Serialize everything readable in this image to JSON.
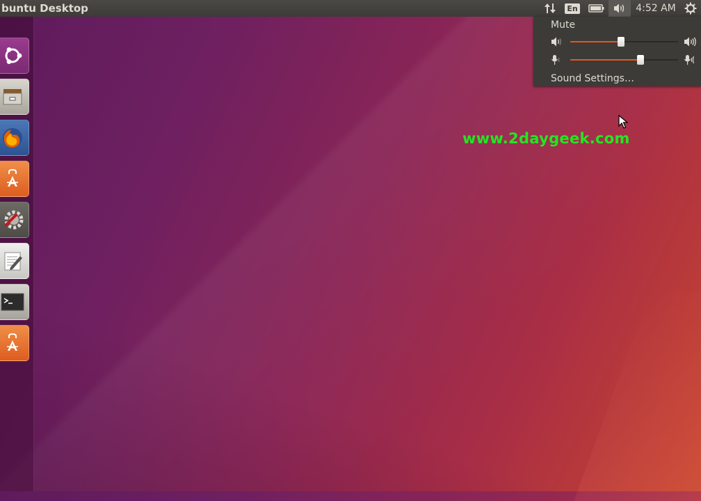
{
  "panel": {
    "title": "buntu Desktop",
    "language": "En",
    "clock": "4:52 AM"
  },
  "launcher": {
    "items": [
      {
        "name": "dash-home",
        "icon": "ubuntu-logo-icon"
      },
      {
        "name": "files",
        "icon": "file-cabinet-icon"
      },
      {
        "name": "firefox",
        "icon": "firefox-icon"
      },
      {
        "name": "software-center",
        "icon": "shopping-bag-icon"
      },
      {
        "name": "system-settings",
        "icon": "gear-wrench-icon"
      },
      {
        "name": "text-editor",
        "icon": "notepad-pencil-icon"
      },
      {
        "name": "terminal",
        "icon": "terminal-icon"
      },
      {
        "name": "software-updater",
        "icon": "shopping-bag-icon"
      }
    ]
  },
  "sound_menu": {
    "mute_label": "Mute",
    "volume_level": 0.47,
    "mic_level": 0.65,
    "settings_label": "Sound Settings…"
  },
  "watermark": "www.2daygeek.com",
  "colors": {
    "panel_bg": "#3c3b37",
    "panel_text": "#dfdbd2",
    "accent": "#e95420",
    "watermark": "#22e622"
  }
}
